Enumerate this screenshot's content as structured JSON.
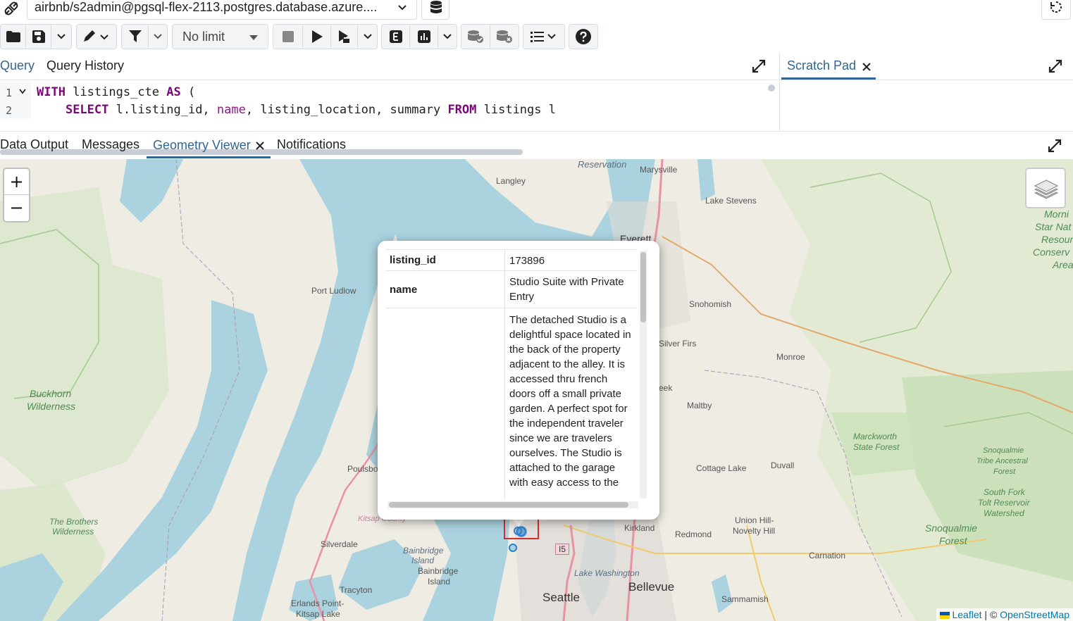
{
  "connection": {
    "title": "airbnb/s2admin@pgsql-flex-2113.postgres.database.azure...."
  },
  "toolbar": {
    "limit_label": "No limit"
  },
  "query_tabs": {
    "query": "Query",
    "history": "Query History",
    "scratch": "Scratch Pad"
  },
  "editor": {
    "line_numbers": [
      "1",
      "2"
    ],
    "line1": {
      "kw1": "WITH",
      "t1": " listings_cte ",
      "kw2": "AS",
      "t2": " ("
    },
    "line2": {
      "kw1": "SELECT",
      "t1": " l.listing_id, ",
      "kw2": "name",
      "t2": ", listing_location, summary ",
      "kw3": "FROM",
      "t3": " listings l"
    }
  },
  "result_tabs": {
    "data_output": "Data Output",
    "messages": "Messages",
    "geometry_viewer": "Geometry Viewer",
    "notifications": "Notifications"
  },
  "map": {
    "zoom_in": "+",
    "zoom_out": "−",
    "popup": {
      "rows": [
        {
          "key": "listing_id",
          "value": "173896"
        },
        {
          "key": "name",
          "value": "Studio Suite with Private Entry"
        },
        {
          "key": "",
          "value": "The detached Studio is a delightful space located in the back of the property adjacent to the alley. It is accessed thru french doors off a small private garden. A perfect spot for the independent traveler since we are travelers ourselves. The Studio is attached to the garage with easy access to the"
        }
      ]
    },
    "labels": {
      "reservation": "Reservation",
      "marysville": "Marysville",
      "langley": "Langley",
      "lake_stevens": "Lake Stevens",
      "everett": "Everett",
      "port_ludlow": "Port Ludlow",
      "snohomish": "Snohomish",
      "silver_firs": "Silver Firs",
      "monroe": "Monroe",
      "buckhorn": "Buckhorn",
      "wilderness": "Wilderness",
      "creek": "eek",
      "maltby": "Maltby",
      "marckworth": "Marckworth",
      "state_forest": "State Forest",
      "poulsbo": "Poulsbo",
      "cottage_lake": "Cottage Lake",
      "duvall": "Duvall",
      "snoqualmie_tribe1": "Snoqualmie",
      "snoqualmie_tribe2": "Tribe Ancestral",
      "snoqualmie_tribe3": "Forest",
      "south_fork1": "South Fork",
      "south_fork2": "Tolt Reservoir",
      "south_fork3": "Watershed",
      "brothers1": "The Brothers",
      "brothers2": "Wilderness",
      "kitsap": "Kitsap County",
      "kirkland": "Kirkland",
      "union_hill1": "Union Hill-",
      "union_hill2": "Novelty Hill",
      "redmond": "Redmond",
      "snoq_forest1": "Snoqualmie",
      "snoq_forest2": "Forest",
      "silverdale": "Silverdale",
      "bainbridge_island1": "Bainbridge",
      "bainbridge_island2": "Island",
      "bainbridge1": "Bainbridge",
      "bainbridge2": "Island",
      "i5": "I5",
      "carnation": "Carnation",
      "lake_washington": "Lake Washington",
      "bellevue": "Bellevue",
      "tracyton": "Tracyton",
      "seattle": "Seattle",
      "sammamish": "Sammamish",
      "erlands": "Erlands Point-",
      "kitsap_lake": "Kitsap Lake",
      "morning1": "Morni",
      "morning2": "Star Nat",
      "morning3": "Resour",
      "morning4": "Conserv",
      "morning5": "Area"
    },
    "attribution": {
      "leaflet": "Leaflet",
      "sep": " | © ",
      "osm": "OpenStreetMap"
    }
  },
  "colors": {
    "accent": "#326690",
    "water": "#aad3df",
    "land": "#efece4",
    "park": "#cde2bd",
    "marker": "#2a81cb",
    "highlight": "#d32f2f"
  }
}
